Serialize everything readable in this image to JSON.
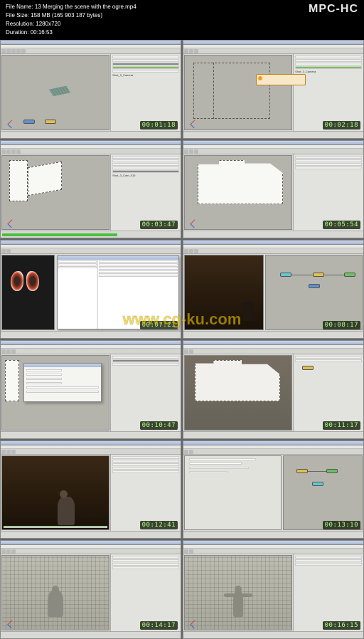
{
  "header": {
    "file_name_label": "File Name:",
    "file_name": "13 Merging the scene with the ogre.mp4",
    "file_size_label": "File Size:",
    "file_size": "158 MB (165 903 187 bytes)",
    "resolution_label": "Resolution:",
    "resolution": "1280x720",
    "duration_label": "Duration:",
    "duration": "00:16:53",
    "app_name": "MPC-HC"
  },
  "watermark": "www.cg-ku.com",
  "thumbs": [
    {
      "timecode": "00:01:18",
      "panel_label": "Shot_3_Camera"
    },
    {
      "timecode": "00:02:18"
    },
    {
      "timecode": "00:03:47",
      "panel_label": "Shot_3_Cam_010"
    },
    {
      "timecode": "00:05:54"
    },
    {
      "timecode": "00:07:21"
    },
    {
      "timecode": "00:08:17"
    },
    {
      "timecode": "00:10:47"
    },
    {
      "timecode": "00:11:17"
    },
    {
      "timecode": "00:12:41"
    },
    {
      "timecode": "00:13:10"
    },
    {
      "timecode": "00:14:17"
    },
    {
      "timecode": "00:16:15"
    }
  ]
}
